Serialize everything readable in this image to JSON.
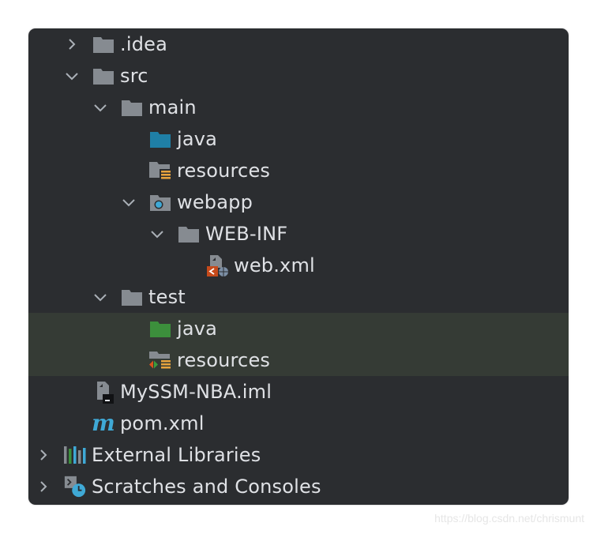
{
  "tree": {
    "items": [
      {
        "label": ".idea",
        "depth": 0,
        "expanded": false,
        "icon": "folder-icon"
      },
      {
        "label": "src",
        "depth": 0,
        "expanded": true,
        "icon": "folder-icon"
      },
      {
        "label": "main",
        "depth": 1,
        "expanded": true,
        "icon": "folder-icon"
      },
      {
        "label": "java",
        "depth": 2,
        "expanded": null,
        "icon": "source-folder-icon"
      },
      {
        "label": "resources",
        "depth": 2,
        "expanded": null,
        "icon": "resources-folder-icon"
      },
      {
        "label": "webapp",
        "depth": 2,
        "expanded": true,
        "icon": "web-folder-icon"
      },
      {
        "label": "WEB-INF",
        "depth": 3,
        "expanded": true,
        "icon": "folder-icon"
      },
      {
        "label": "web.xml",
        "depth": 4,
        "expanded": null,
        "icon": "web-xml-icon"
      },
      {
        "label": "test",
        "depth": 1,
        "expanded": true,
        "icon": "folder-icon"
      },
      {
        "label": "java",
        "depth": 2,
        "expanded": null,
        "icon": "test-source-folder-icon",
        "selected": true
      },
      {
        "label": "resources",
        "depth": 2,
        "expanded": null,
        "icon": "test-resources-folder-icon",
        "selected": true
      },
      {
        "label": "MySSM-NBA.iml",
        "depth": 0,
        "expanded": null,
        "icon": "iml-file-icon"
      },
      {
        "label": "pom.xml",
        "depth": 0,
        "expanded": null,
        "icon": "maven-icon"
      },
      {
        "label": "External Libraries",
        "depth": -1,
        "expanded": false,
        "icon": "libraries-icon"
      },
      {
        "label": "Scratches and Consoles",
        "depth": -1,
        "expanded": false,
        "icon": "scratches-icon"
      }
    ]
  },
  "colors": {
    "panel": "#2b2d30",
    "selection": "#353b35",
    "text": "#dfe1e5",
    "folder": "#868b91",
    "source_folder": "#1f7fa6",
    "test_folder": "#3c8f3c",
    "resources_lines": "#e8a33d"
  },
  "watermark": "https://blog.csdn.net/chrismunt"
}
